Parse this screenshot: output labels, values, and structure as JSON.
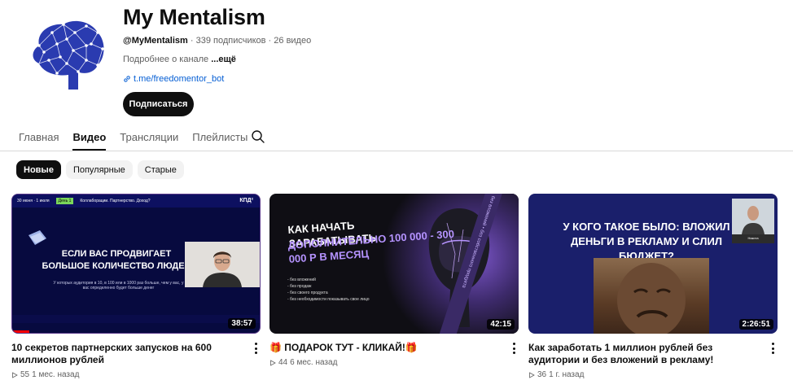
{
  "channel": {
    "name": "My Mentalism",
    "handle": "@MyMentalism",
    "stats": " · 339 подписчиков · 26 видео",
    "about": "Подробнее о канале ",
    "about_more": "...ещё",
    "link": "t.me/freedomentor_bot",
    "subscribe_label": "Подписаться"
  },
  "tabs": [
    {
      "label": "Главная",
      "active": false
    },
    {
      "label": "Видео",
      "active": true
    },
    {
      "label": "Трансляции",
      "active": false
    },
    {
      "label": "Плейлисты",
      "active": false
    }
  ],
  "chips": [
    {
      "label": "Новые",
      "active": true
    },
    {
      "label": "Популярные",
      "active": false
    },
    {
      "label": "Старые",
      "active": false
    }
  ],
  "videos": [
    {
      "title": "10 секретов партнерских запусков на 600 миллионов рублей",
      "views": "55",
      "age": "1 мес. назад",
      "duration": "38:57",
      "watched_fraction": 0.07,
      "thumb_text": {
        "date": "30 июня · 1 июля",
        "day": "День 1",
        "topic": "Коллаборации. Партнерство. Доход?",
        "brand": "КПД²",
        "headline": "ЕСЛИ ВАС ПРОДВИГАЕТ БОЛЬШОЕ КОЛИЧЕСТВО ЛЮДЕЙ",
        "sub": "У которых аудитория в 10, в 100 или в 1000 раз больше, чем у вас, у вас определенно будет больше денег"
      }
    },
    {
      "title": "🎁 ПОДАРОК ТУТ - КЛИКАЙ!🎁",
      "views": "44",
      "age": "6 мес. назад",
      "duration": "42:15",
      "thumb_text": {
        "line1": "КАК НАЧАТЬ ЗАРАБАТЫВАТЬ",
        "line2": "ДОПОЛНИТЕЛЬНО 100 000 - 300 000 Р В МЕСЯЦ",
        "bullets": [
          "- без вложений",
          "- без продаж",
          "- без своего продукта",
          "- без необходимости показывать свое лицо"
        ],
        "strip": "без вложений • без собственного продукта"
      }
    },
    {
      "title": "Как заработать 1 миллион рублей без аудитории и без вложений в рекламу!",
      "views": "36",
      "age": "1 г. назад",
      "duration": "2:26:51",
      "thumb_text": {
        "headline": "У КОГО ТАКОЕ БЫЛО: ВЛОЖИЛ ДЕНЬГИ В РЕКЛАМУ И СЛИЛ БЮДЖЕТ?",
        "cam_label": "Никита"
      }
    }
  ],
  "colors": {
    "accent_link": "#065fd4",
    "progress": "#ff0000"
  }
}
